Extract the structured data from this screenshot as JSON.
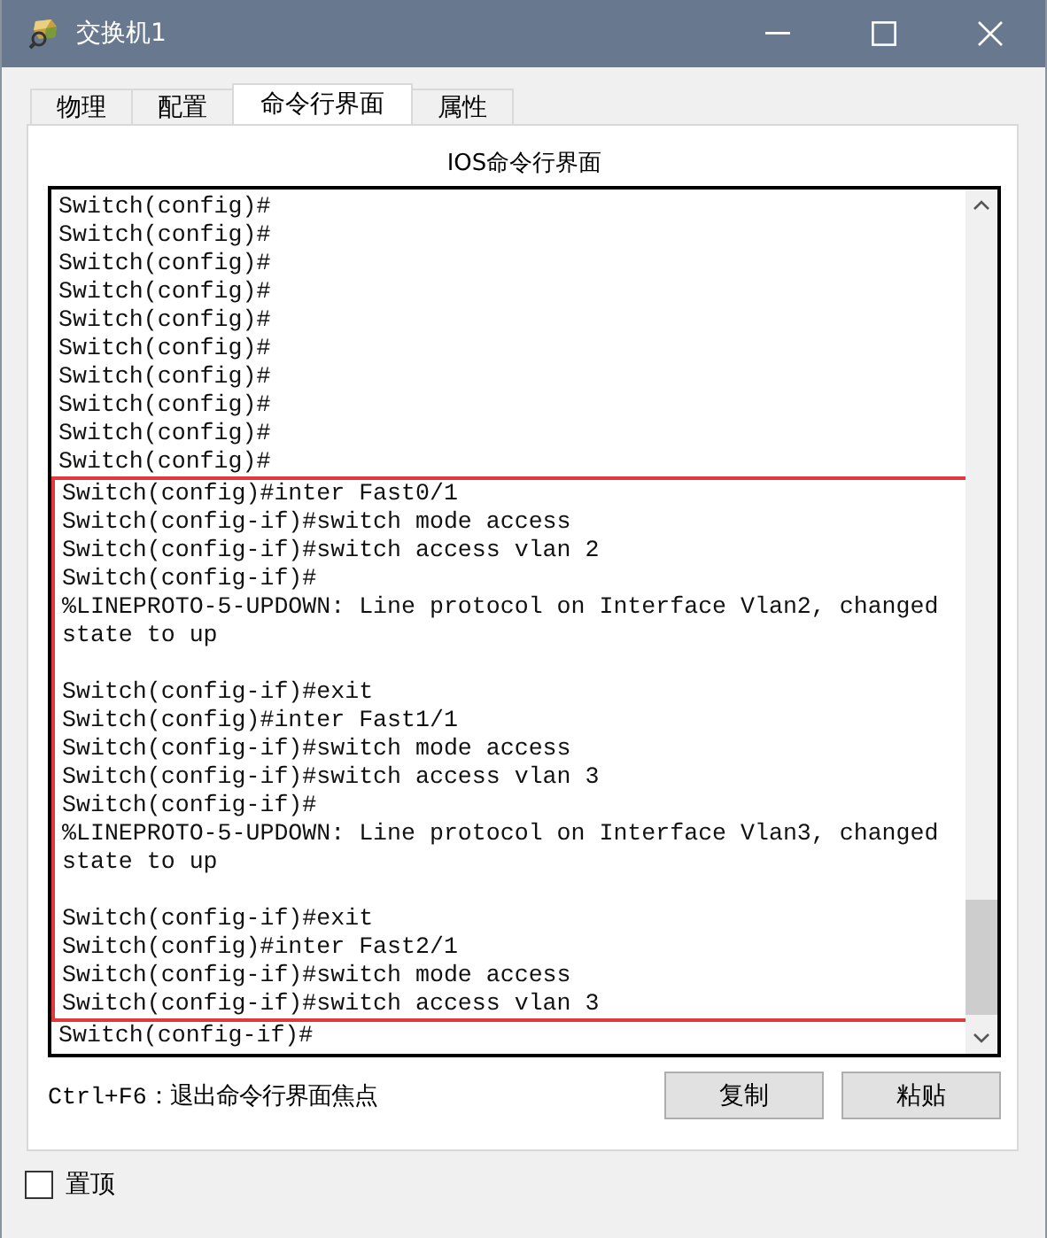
{
  "window": {
    "title": "交换机1"
  },
  "tabs": [
    {
      "label": "物理",
      "selected": false
    },
    {
      "label": "配置",
      "selected": false
    },
    {
      "label": "命令行界面",
      "selected": true
    },
    {
      "label": "属性",
      "selected": false
    }
  ],
  "panel_title": "IOS命令行界面",
  "terminal": {
    "before": [
      {
        "text": "Switch(config)#"
      },
      {
        "text": "Switch(config)#"
      },
      {
        "text": "Switch(config)#"
      },
      {
        "text": "Switch(config)#"
      },
      {
        "text": "Switch(config)#"
      },
      {
        "text": "Switch(config)#"
      },
      {
        "text": "Switch(config)#"
      },
      {
        "text": "Switch(config)#"
      },
      {
        "text": "Switch(config)#"
      },
      {
        "text": "Switch(config)#"
      }
    ],
    "highlighted": [
      {
        "text": "Switch(config)#inter Fast0/1"
      },
      {
        "text": "Switch(config-if)#switch mode access"
      },
      {
        "text": "Switch(config-if)#switch access vlan 2"
      },
      {
        "text": "Switch(config-if)#"
      },
      {
        "text": "%LINEPROTO-5-UPDOWN: Line protocol on Interface Vlan2, changed"
      },
      {
        "text": "state to up",
        "blank_after": true
      },
      {
        "text": "Switch(config-if)#exit"
      },
      {
        "text": "Switch(config)#inter Fast1/1"
      },
      {
        "text": "Switch(config-if)#switch mode access"
      },
      {
        "text": "Switch(config-if)#switch access vlan 3"
      },
      {
        "text": "Switch(config-if)#"
      },
      {
        "text": "%LINEPROTO-5-UPDOWN: Line protocol on Interface Vlan3, changed"
      },
      {
        "text": "state to up",
        "blank_after": true
      },
      {
        "text": "Switch(config-if)#exit"
      },
      {
        "text": "Switch(config)#inter Fast2/1"
      },
      {
        "text": "Switch(config-if)#switch mode access"
      },
      {
        "text": "Switch(config-if)#switch access vlan 3"
      }
    ],
    "after": [
      {
        "text": "Switch(config-if)#"
      }
    ]
  },
  "shortcut_hint": "Ctrl+F6：退出命令行界面焦点",
  "buttons": [
    "复制",
    "粘贴"
  ],
  "always_on_top": {
    "label": "置顶",
    "checked": false
  }
}
